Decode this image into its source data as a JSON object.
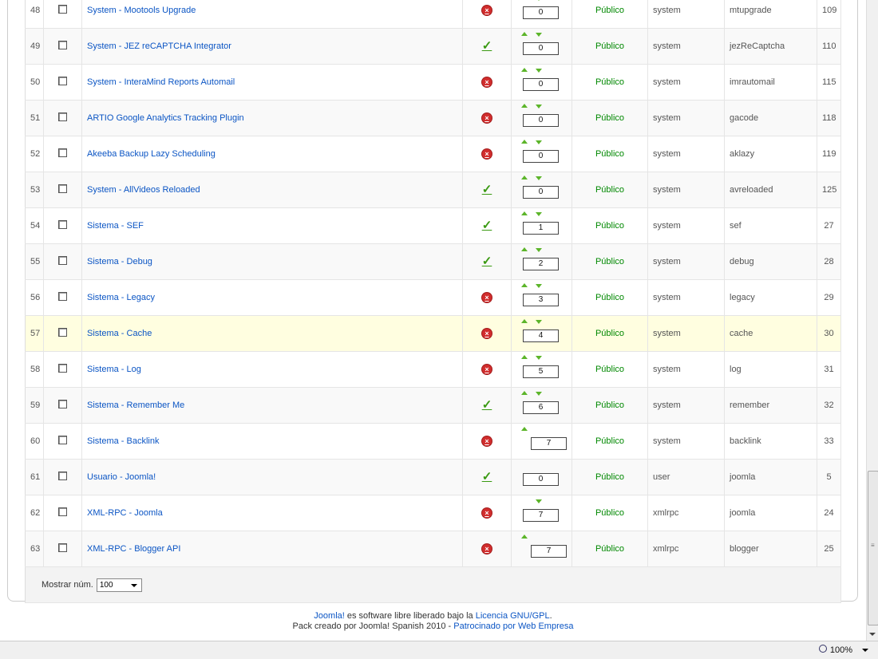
{
  "table": {
    "rows": [
      {
        "num": "48",
        "name": "System - Mootools Upgrade",
        "enabled": false,
        "up": true,
        "down": true,
        "order": "0",
        "access": "Público",
        "type": "system",
        "element": "mtupgrade",
        "id": "109"
      },
      {
        "num": "49",
        "name": "System - JEZ reCAPTCHA Integrator",
        "enabled": true,
        "up": true,
        "down": true,
        "order": "0",
        "access": "Público",
        "type": "system",
        "element": "jezReCaptcha",
        "id": "110"
      },
      {
        "num": "50",
        "name": "System - InteraMind Reports Automail",
        "enabled": false,
        "up": true,
        "down": true,
        "order": "0",
        "access": "Público",
        "type": "system",
        "element": "imrautomail",
        "id": "115"
      },
      {
        "num": "51",
        "name": "ARTIO Google Analytics Tracking Plugin",
        "enabled": false,
        "up": true,
        "down": true,
        "order": "0",
        "access": "Público",
        "type": "system",
        "element": "gacode",
        "id": "118"
      },
      {
        "num": "52",
        "name": "Akeeba Backup Lazy Scheduling",
        "enabled": false,
        "up": true,
        "down": true,
        "order": "0",
        "access": "Público",
        "type": "system",
        "element": "aklazy",
        "id": "119"
      },
      {
        "num": "53",
        "name": "System - AllVideos Reloaded",
        "enabled": true,
        "up": true,
        "down": true,
        "order": "0",
        "access": "Público",
        "type": "system",
        "element": "avreloaded",
        "id": "125"
      },
      {
        "num": "54",
        "name": "Sistema - SEF",
        "enabled": true,
        "up": true,
        "down": true,
        "order": "1",
        "access": "Público",
        "type": "system",
        "element": "sef",
        "id": "27"
      },
      {
        "num": "55",
        "name": "Sistema - Debug",
        "enabled": true,
        "up": true,
        "down": true,
        "order": "2",
        "access": "Público",
        "type": "system",
        "element": "debug",
        "id": "28"
      },
      {
        "num": "56",
        "name": "Sistema - Legacy",
        "enabled": false,
        "up": true,
        "down": true,
        "order": "3",
        "access": "Público",
        "type": "system",
        "element": "legacy",
        "id": "29"
      },
      {
        "num": "57",
        "name": "Sistema - Cache",
        "enabled": false,
        "up": true,
        "down": true,
        "order": "4",
        "access": "Público",
        "type": "system",
        "element": "cache",
        "id": "30",
        "highlight": true
      },
      {
        "num": "58",
        "name": "Sistema - Log",
        "enabled": false,
        "up": true,
        "down": true,
        "order": "5",
        "access": "Público",
        "type": "system",
        "element": "log",
        "id": "31"
      },
      {
        "num": "59",
        "name": "Sistema - Remember Me",
        "enabled": true,
        "up": true,
        "down": true,
        "order": "6",
        "access": "Público",
        "type": "system",
        "element": "remember",
        "id": "32"
      },
      {
        "num": "60",
        "name": "Sistema - Backlink",
        "enabled": false,
        "up": true,
        "down": false,
        "order": "7",
        "access": "Público",
        "type": "system",
        "element": "backlink",
        "id": "33"
      },
      {
        "num": "61",
        "name": "Usuario - Joomla!",
        "enabled": true,
        "up": false,
        "down": false,
        "order": "0",
        "access": "Público",
        "type": "user",
        "element": "joomla",
        "id": "5"
      },
      {
        "num": "62",
        "name": "XML-RPC - Joomla",
        "enabled": false,
        "up": false,
        "down": true,
        "order": "7",
        "access": "Público",
        "type": "xmlrpc",
        "element": "joomla",
        "id": "24"
      },
      {
        "num": "63",
        "name": "XML-RPC - Blogger API",
        "enabled": false,
        "up": true,
        "down": false,
        "order": "7",
        "access": "Público",
        "type": "xmlrpc",
        "element": "blogger",
        "id": "25"
      }
    ]
  },
  "footer": {
    "limit_label": "Mostrar núm.",
    "limit_value": "100"
  },
  "copyright": {
    "line1_link1": "Joomla!",
    "line1_text": " es software libre liberado bajo la ",
    "line1_link2": "Licencia GNU/GPL",
    "line1_end": ".",
    "line2_text1": "Pack creado por Joomla! Spanish 2010 - ",
    "line2_link": "Patrocinado por Web Empresa"
  },
  "statusbar": {
    "zoom": "100%"
  },
  "icons": {
    "enabled": "check-icon",
    "disabled": "disabled-x-icon",
    "order_up": "order-up-icon",
    "order_down": "order-down-icon"
  },
  "colors": {
    "link": "#0b55c4",
    "access": "#008800",
    "enabled": "#3a9a12",
    "disabled": "#d12d2d",
    "highlight_row": "#fffee0"
  }
}
